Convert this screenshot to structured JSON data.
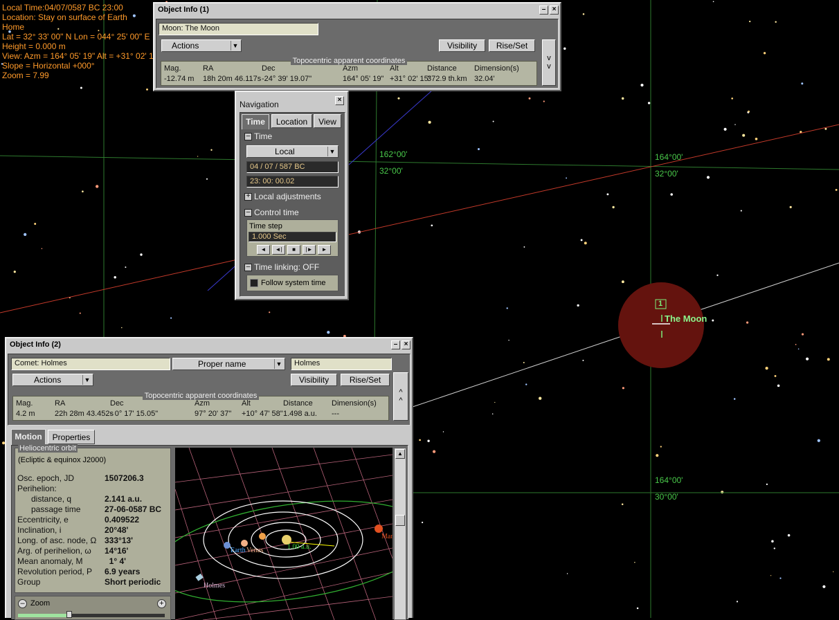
{
  "hud": {
    "lines": [
      "Local Time:04/07/0587 BC 23:00",
      "Location: Stay on surface of Earth",
      "Home",
      "Lat = 32° 33' 00\" N   Lon = 044° 25' 00\" E",
      "Height = 0.000 m",
      "View: Azm = 164° 05' 19\"  Alt = +31° 02' 15\"",
      "Slope = Horizontal +000°",
      "Zoom = 7.99"
    ],
    "color": "#ff9a2a"
  },
  "sky_labels": {
    "lbl1": "162°00'",
    "lbl2": "32°00'",
    "lbl3": "164°00'",
    "lbl4": "32°00'",
    "lbl5": "164°00'",
    "lbl6": "30°00'"
  },
  "moon": {
    "label": "The Moon",
    "marker": "1"
  },
  "oi1": {
    "title": "Object Info (1)",
    "object": "Moon: The Moon",
    "actions": "Actions",
    "visibility": "Visibility",
    "riseset": "Rise/Set",
    "expand": "v\nv",
    "coords_title": "Topocentric apparent coordinates",
    "headers": [
      "Mag.",
      "RA",
      "Dec",
      "Azm",
      "Alt",
      "Distance",
      "Dimension(s)"
    ],
    "values": [
      "-12.74 m",
      "18h 20m 46.117s",
      "-24° 39' 19.07\"",
      "164° 05' 19\"",
      "+31° 02' 15\"",
      "372.9 th.km",
      "32.04'"
    ]
  },
  "nav": {
    "title": "Navigation",
    "tabs": [
      "Time",
      "Location",
      "View"
    ],
    "time_section": "Time",
    "mode": "Local",
    "date": "04 / 07 /  587    BC",
    "clock": "23:  00: 00.02",
    "local_adj": "Local adjustments",
    "control_time": "Control time",
    "time_step_label": "Time step",
    "time_step": "1.000      Sec",
    "controls": [
      "◄",
      "◄|",
      "■",
      "|►",
      "►"
    ],
    "time_linking": "Time linking: OFF",
    "follow": "Follow system time"
  },
  "oi2": {
    "title": "Object Info (2)",
    "object": "Comet: Holmes",
    "name_type": "Proper name",
    "name": "Holmes",
    "actions": "Actions",
    "visibility": "Visibility",
    "riseset": "Rise/Set",
    "expand": "^\n^",
    "coords_title": "Topocentric apparent coordinates",
    "headers": [
      "Mag.",
      "RA",
      "Dec",
      "Azm",
      "Alt",
      "Distance",
      "Dimension(s)"
    ],
    "values": [
      "4.2 m",
      "22h 28m 43.452s",
      "- 0° 17' 15.05\"",
      "97° 20' 37\"",
      "+10° 47' 58\"",
      "1.498 a.u.",
      "---"
    ],
    "tabs": [
      "Motion",
      "Properties"
    ],
    "orbit_title": "Heliocentric orbit",
    "orbit_sub": "(Ecliptic & equinox J2000)",
    "orbit": [
      [
        "Osc. epoch, JD",
        "1507206.3"
      ],
      [
        "Perihelion:",
        ""
      ],
      [
        "      distance, q",
        "2.141 a.u."
      ],
      [
        "      passage time",
        "27-06-0587 BC"
      ],
      [
        "Eccentricity, e",
        "0.409522"
      ],
      [
        "Inclination, i",
        "20°48'"
      ],
      [
        "Long. of asc. node, Ω",
        "333°13'"
      ],
      [
        "Arg. of perihelion, ω",
        "14°16'"
      ],
      [
        "Mean anomaly, M",
        "  1° 4'"
      ],
      [
        "Revolution period, P",
        "6.9 years"
      ],
      [
        "Group",
        "Short periodic"
      ]
    ],
    "zoom_label": "Zoom",
    "zoom_level": 0.35,
    "plot_labels": {
      "earth": "Earth",
      "venus": "Venus",
      "scale": "1.00 a.u.",
      "mars": "Mars",
      "holmes": "Holmes"
    }
  }
}
